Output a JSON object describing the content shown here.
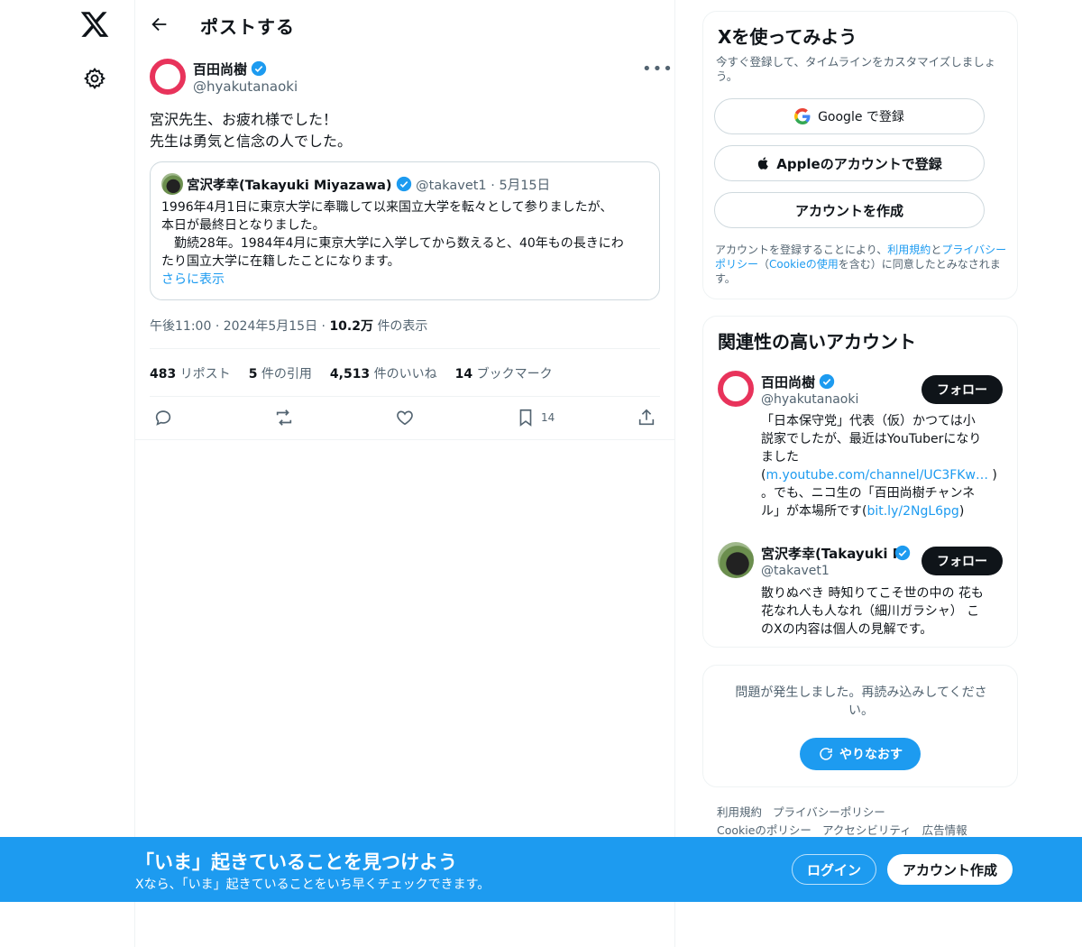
{
  "header": {
    "title": "ポストする"
  },
  "post": {
    "author_name": "百田尚樹",
    "author_handle": "@hyakutanaoki",
    "text_line1": "宮沢先生、お疲れ様でした！",
    "text_line2": "先生は勇気と信念の人でした。",
    "quote": {
      "name": "宮沢孝幸(Takayuki Miyazawa)",
      "handle": "@takavet1",
      "sep": "·",
      "date": "5月15日",
      "line1": "1996年4月1日に東京大学に奉職して以来国立大学を転々として参りましたが、",
      "line2": "本日が最終日となりました。",
      "line3": "　勤続28年。1984年4月に東京大学に入学してから数えると、40年もの長きにわ",
      "line4": "たり国立大学に在籍したことになります。",
      "show_more": "さらに表示"
    },
    "time": "午後11:00",
    "sep": "·",
    "date": "2024年5月15日",
    "views_count": "10.2万",
    "views_label": "件の表示",
    "stats": {
      "reposts_count": "483",
      "reposts_label": "リポスト",
      "quotes_count": "5",
      "quotes_label": "件の引用",
      "likes_count": "4,513",
      "likes_label": "件のいいね",
      "bookmarks_count": "14",
      "bookmarks_label": "ブックマーク"
    },
    "bookmark_count_small": "14"
  },
  "signup": {
    "title": "Xを使ってみよう",
    "subtitle": "今すぐ登録して、タイムラインをカスタマイズしましょう。",
    "google_label": "Google で登録",
    "apple_label": "Appleのアカウントで登録",
    "create_label": "アカウントを作成",
    "terms_pre": "アカウントを登録することにより、",
    "terms_link": "利用規約",
    "terms_and": "と",
    "privacy_link": "プライバシーポリシー",
    "terms_mid": "（",
    "cookie_link": "Cookieの使用",
    "terms_post": "を含む）に同意したとみなされます。"
  },
  "related": {
    "title": "関連性の高いアカウント",
    "follow_label": "フォロー",
    "accounts": [
      {
        "name": "百田尚樹",
        "handle": "@hyakutanaoki",
        "bio1": "「日本保守党」代表（仮）かつては小",
        "bio2": "説家でしたが、最近はYouTuberになり",
        "bio3": "ました",
        "bio4_pre": "(",
        "bio4_link": "m.youtube.com/channel/UC3FKw…",
        "bio4_post": " )",
        "bio5": "。でも、ニコ生の「百田尚樹チャンネ",
        "bio6_pre": "ル」が本場所です(",
        "bio6_link": "bit.ly/2NgL6pg",
        "bio6_post": ")"
      },
      {
        "name": "宮沢孝幸(Takayuki M",
        "handle": "@takavet1",
        "bio1": "散りぬべき 時知りてこそ世の中の 花も",
        "bio2": "花なれ人も人なれ（細川ガラシャ） こ",
        "bio3": "のXの内容は個人の見解です。"
      }
    ]
  },
  "error_card": {
    "message1": "問題が発生しました。再読み込みしてくださ",
    "message2": "い。",
    "retry_label": "やりなおす"
  },
  "footer": {
    "terms": "利用規約",
    "privacy": "プライバシーポリシー",
    "cookie": "Cookieのポリシー",
    "accessibility": "アクセシビリティ",
    "ads": "広告情報"
  },
  "banner": {
    "title": "「いま」起きていることを見つけよう",
    "subtitle": "Xなら、「いま」起きていることをいち早くチェックできます。",
    "login_label": "ログイン",
    "signup_label": "アカウント作成"
  },
  "colors": {
    "accent": "#1d9bf0",
    "brand_ring": "#e8335b"
  }
}
